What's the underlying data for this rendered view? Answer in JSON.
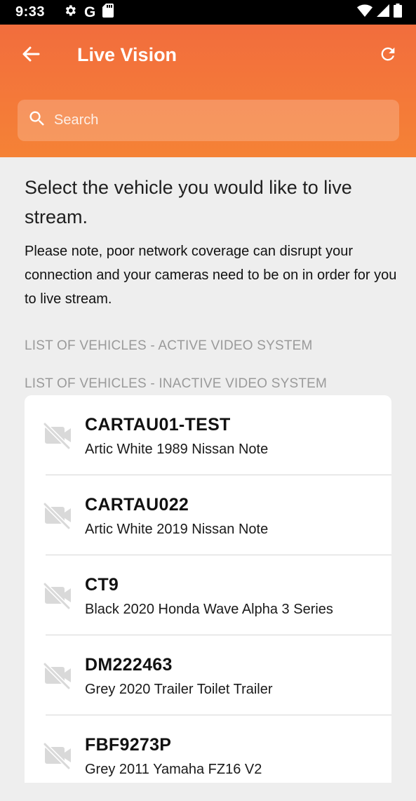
{
  "status_bar": {
    "time": "9:33",
    "icons": [
      "gear-icon",
      "google-g-icon",
      "sd-card-icon",
      "wifi-icon",
      "signal-icon",
      "battery-icon"
    ],
    "g_glyph": "G"
  },
  "app_bar": {
    "title": "Live Vision",
    "back_icon": "back-arrow-icon",
    "refresh_icon": "refresh-icon",
    "background_color": "#f47337"
  },
  "search": {
    "placeholder": "Search",
    "value": ""
  },
  "main": {
    "heading": "Select the vehicle you would like to live stream.",
    "note": "Please note, poor network coverage can disrupt your connection and your cameras need to be on in order for you to live stream.",
    "active_section_label": "LIST OF VEHICLES - ACTIVE VIDEO SYSTEM",
    "inactive_section_label": "LIST OF VEHICLES - INACTIVE VIDEO SYSTEM"
  },
  "vehicles": [
    {
      "name": "CARTAU01-TEST",
      "description": "Artic White 1989 Nissan Note",
      "icon": "video-off-icon"
    },
    {
      "name": "CARTAU022",
      "description": "Artic White 2019 Nissan Note",
      "icon": "video-off-icon"
    },
    {
      "name": "CT9",
      "description": "Black 2020 Honda Wave Alpha 3 Series",
      "icon": "video-off-icon"
    },
    {
      "name": "DM222463",
      "description": "Grey 2020 Trailer Toilet Trailer",
      "icon": "video-off-icon"
    },
    {
      "name": "FBF9273P",
      "description": "Grey 2011 Yamaha FZ16 V2",
      "icon": "video-off-icon"
    }
  ]
}
